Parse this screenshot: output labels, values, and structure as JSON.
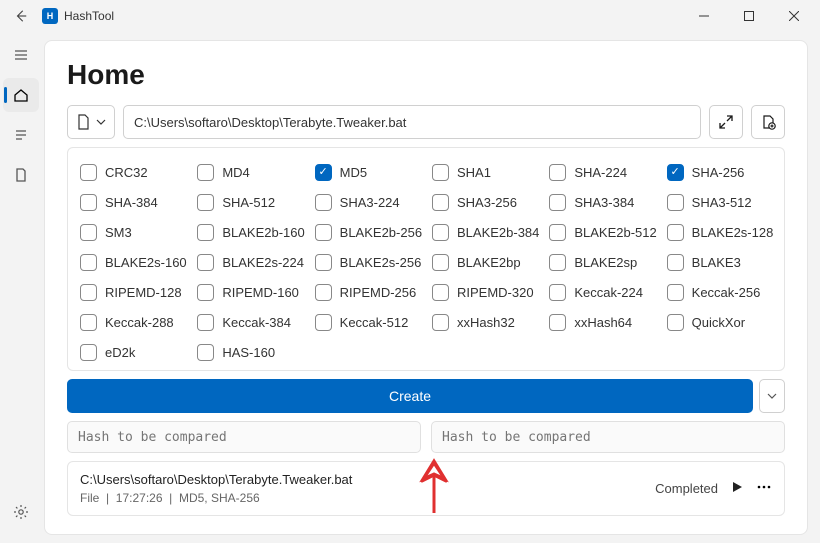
{
  "titlebar": {
    "app_name": "HashTool"
  },
  "page": {
    "title": "Home"
  },
  "path_input": {
    "value": "C:\\Users\\softaro\\Desktop\\Terabyte.Tweaker.bat"
  },
  "algorithms": [
    {
      "id": "crc32",
      "label": "CRC32",
      "checked": false
    },
    {
      "id": "md4",
      "label": "MD4",
      "checked": false
    },
    {
      "id": "md5",
      "label": "MD5",
      "checked": true
    },
    {
      "id": "sha1",
      "label": "SHA1",
      "checked": false
    },
    {
      "id": "sha224",
      "label": "SHA-224",
      "checked": false
    },
    {
      "id": "sha256",
      "label": "SHA-256",
      "checked": true
    },
    {
      "id": "sha384",
      "label": "SHA-384",
      "checked": false
    },
    {
      "id": "sha512",
      "label": "SHA-512",
      "checked": false
    },
    {
      "id": "sha3224",
      "label": "SHA3-224",
      "checked": false
    },
    {
      "id": "sha3256",
      "label": "SHA3-256",
      "checked": false
    },
    {
      "id": "sha3384",
      "label": "SHA3-384",
      "checked": false
    },
    {
      "id": "sha3512",
      "label": "SHA3-512",
      "checked": false
    },
    {
      "id": "sm3",
      "label": "SM3",
      "checked": false
    },
    {
      "id": "blake2b160",
      "label": "BLAKE2b-160",
      "checked": false
    },
    {
      "id": "blake2b256",
      "label": "BLAKE2b-256",
      "checked": false
    },
    {
      "id": "blake2b384",
      "label": "BLAKE2b-384",
      "checked": false
    },
    {
      "id": "blake2b512",
      "label": "BLAKE2b-512",
      "checked": false
    },
    {
      "id": "blake2s128",
      "label": "BLAKE2s-128",
      "checked": false
    },
    {
      "id": "blake2s160",
      "label": "BLAKE2s-160",
      "checked": false
    },
    {
      "id": "blake2s224",
      "label": "BLAKE2s-224",
      "checked": false
    },
    {
      "id": "blake2s256",
      "label": "BLAKE2s-256",
      "checked": false
    },
    {
      "id": "blake2bp",
      "label": "BLAKE2bp",
      "checked": false
    },
    {
      "id": "blake2sp",
      "label": "BLAKE2sp",
      "checked": false
    },
    {
      "id": "blake3",
      "label": "BLAKE3",
      "checked": false
    },
    {
      "id": "ripemd128",
      "label": "RIPEMD-128",
      "checked": false
    },
    {
      "id": "ripemd160",
      "label": "RIPEMD-160",
      "checked": false
    },
    {
      "id": "ripemd256",
      "label": "RIPEMD-256",
      "checked": false
    },
    {
      "id": "ripemd320",
      "label": "RIPEMD-320",
      "checked": false
    },
    {
      "id": "keccak224",
      "label": "Keccak-224",
      "checked": false
    },
    {
      "id": "keccak256",
      "label": "Keccak-256",
      "checked": false
    },
    {
      "id": "keccak288",
      "label": "Keccak-288",
      "checked": false
    },
    {
      "id": "keccak384",
      "label": "Keccak-384",
      "checked": false
    },
    {
      "id": "keccak512",
      "label": "Keccak-512",
      "checked": false
    },
    {
      "id": "xxhash32",
      "label": "xxHash32",
      "checked": false
    },
    {
      "id": "xxhash64",
      "label": "xxHash64",
      "checked": false
    },
    {
      "id": "quickxor",
      "label": "QuickXor",
      "checked": false
    },
    {
      "id": "ed2k",
      "label": "eD2k",
      "checked": false
    },
    {
      "id": "has160",
      "label": "HAS-160",
      "checked": false
    }
  ],
  "buttons": {
    "create": "Create"
  },
  "compare": {
    "placeholder_left": "Hash to be compared",
    "placeholder_right": "Hash to be compared"
  },
  "result": {
    "path": "C:\\Users\\softaro\\Desktop\\Terabyte.Tweaker.bat",
    "type": "File",
    "time": "17:27:26",
    "algos": "MD5, SHA-256",
    "status": "Completed"
  }
}
